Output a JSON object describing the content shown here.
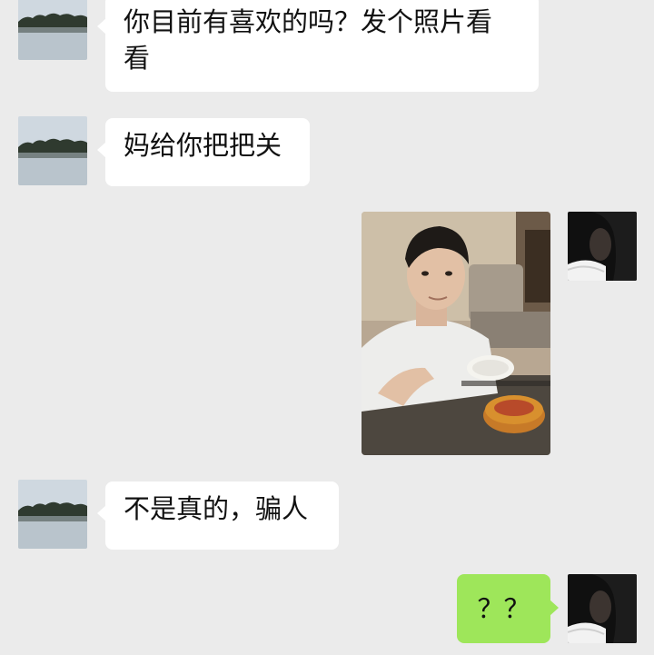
{
  "messages": [
    {
      "side": "incoming",
      "text": "你目前有喜欢的吗？发个照片看看",
      "line1": "你目前有喜欢的吗？发个照片看",
      "line2": "看"
    },
    {
      "side": "incoming",
      "text": "妈给你把把关"
    },
    {
      "side": "outgoing",
      "type": "image",
      "image_icon": "photo-of-young-man-with-cake"
    },
    {
      "side": "incoming",
      "text": "不是真的，骗人"
    },
    {
      "side": "outgoing",
      "text": "？？"
    }
  ],
  "colors": {
    "background": "#ebebeb",
    "incoming_bubble": "#ffffff",
    "outgoing_bubble": "#9ee65a"
  },
  "icons": {
    "contact_avatar": "lake-landscape-avatar",
    "self_avatar": "dark-portrait-avatar"
  }
}
